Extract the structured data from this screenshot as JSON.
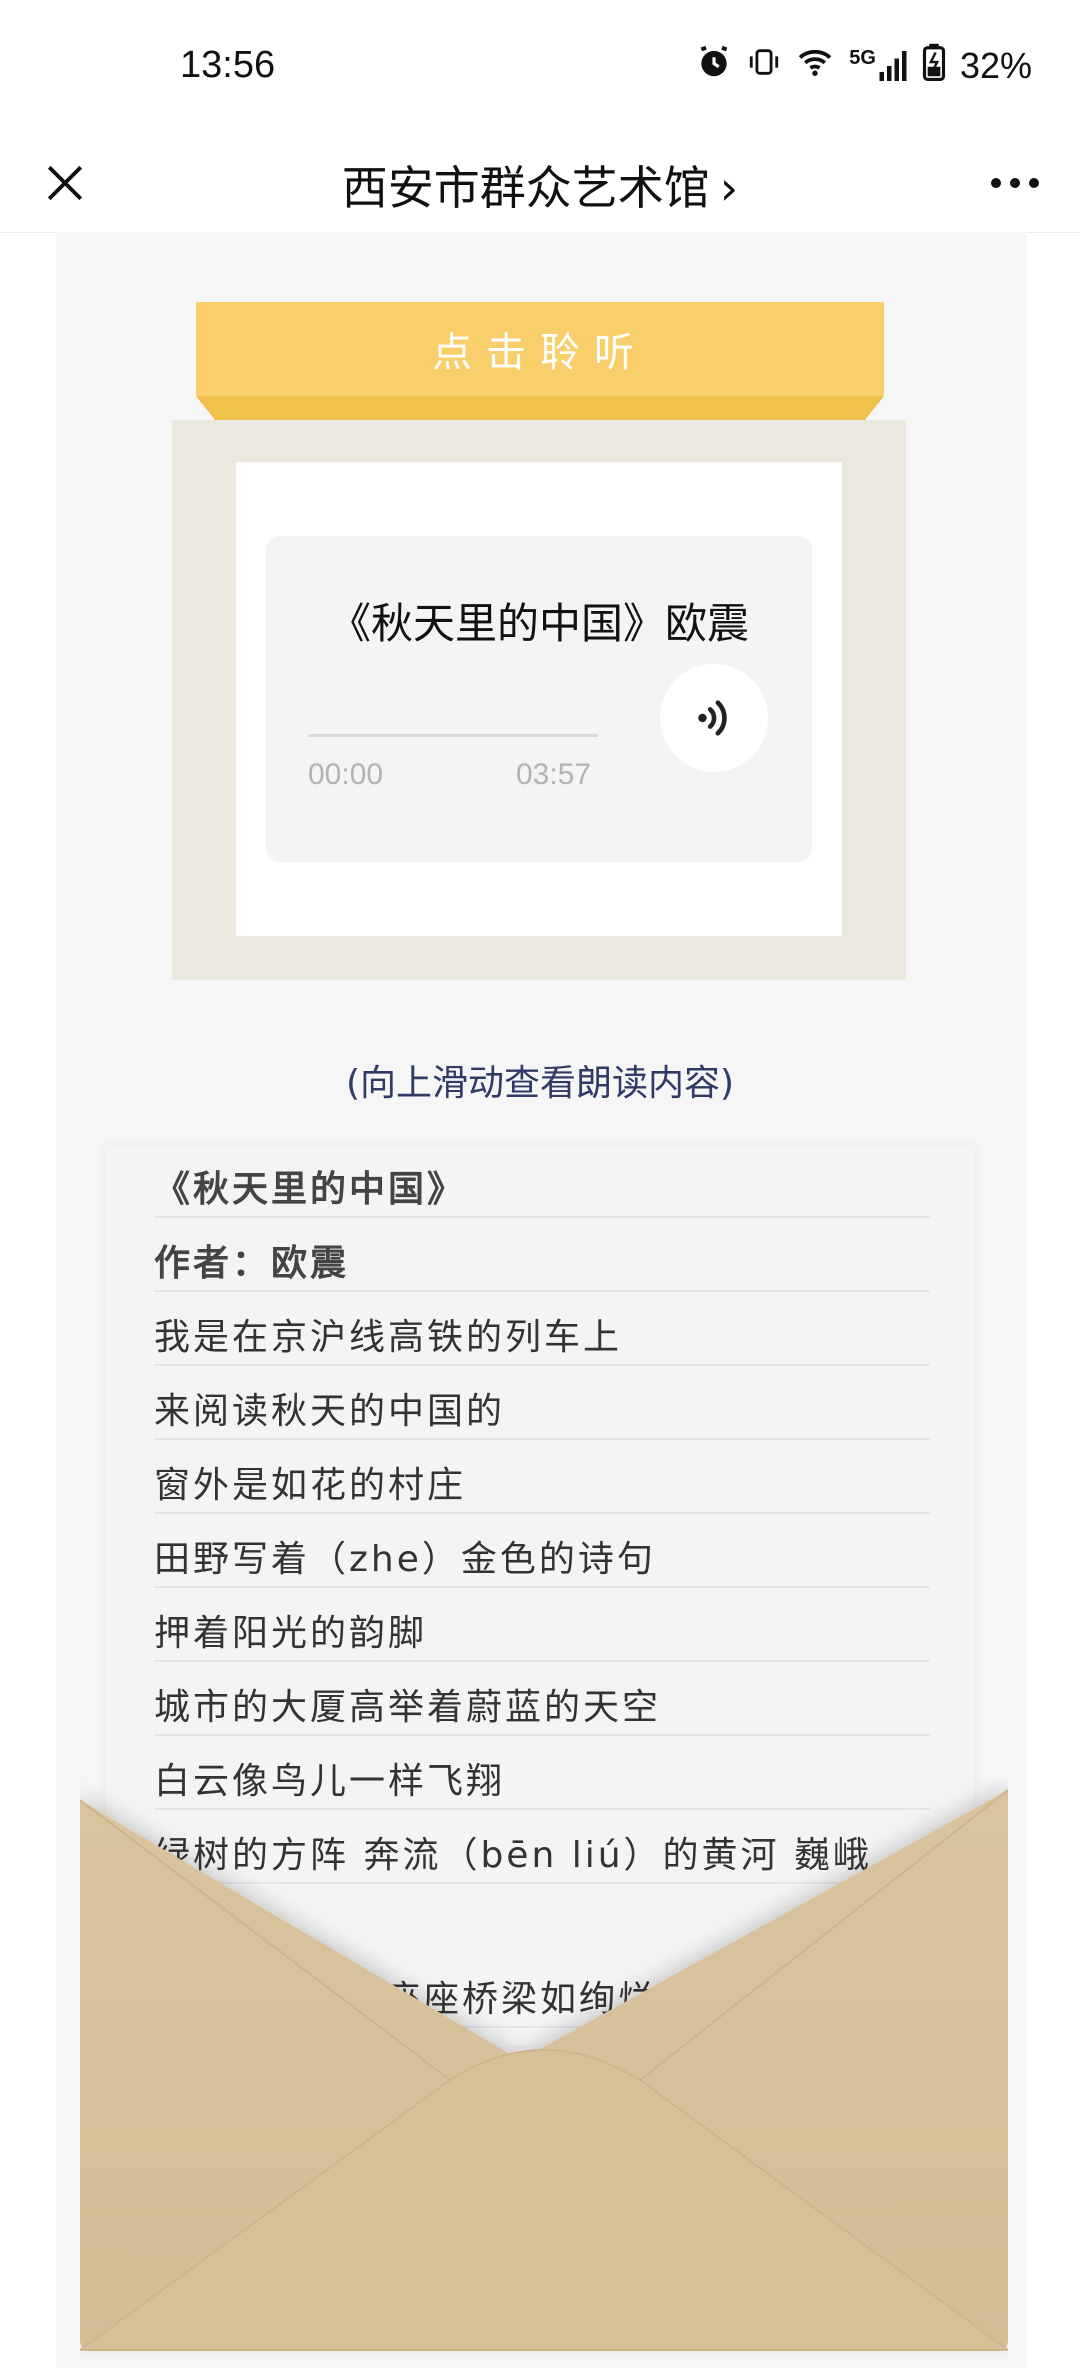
{
  "status_bar": {
    "time": "13:56",
    "network": "5G",
    "battery": "32%"
  },
  "nav": {
    "title": "西安市群众艺术馆",
    "title_chevron": "›",
    "close_icon": "close-icon",
    "more_icon": "more-icon"
  },
  "banner": {
    "label": "点击聆听"
  },
  "player": {
    "title": "《秋天里的中国》欧震",
    "current_time": "00:00",
    "duration": "03:57",
    "progress": 0,
    "button_icon": "sound-icon"
  },
  "hint": "(向上滑动查看朗读内容)",
  "poem": {
    "lines": [
      "《秋天里的中国》",
      "作者：欧震",
      "我是在京沪线高铁的列车上",
      "来阅读秋天的中国的",
      "窗外是如花的村庄",
      "田野写着（zhe）金色的诗句",
      "押着阳光的韵脚",
      "城市的大厦高举着蔚蓝的天空",
      "白云像鸟儿一样飞翔",
      "绿树的方阵 奔流（bēn liú）的黄河 巍峨",
      "座座桥梁如绚烂的"
    ]
  },
  "colors": {
    "banner": "#f9cf6b",
    "frame": "#ebe8e0",
    "envelope": "#d8c29c",
    "hint": "#2f3a66"
  }
}
